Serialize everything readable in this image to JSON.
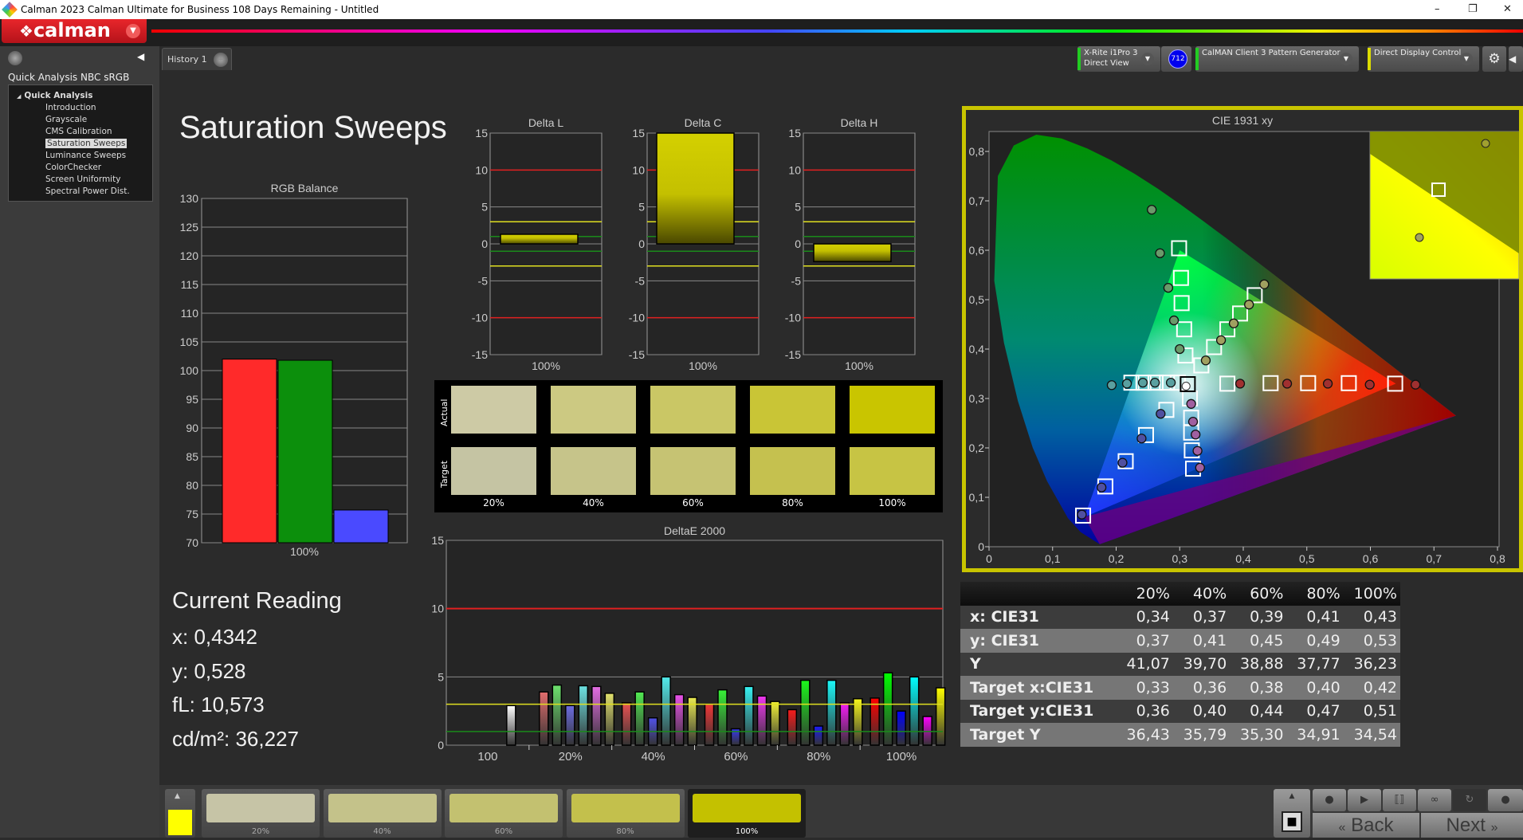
{
  "window": {
    "title": "Calman 2023 Calman Ultimate for Business 108 Days Remaining  - Untitled",
    "min": "–",
    "restore": "❐",
    "close": "✕"
  },
  "logo": {
    "text": "calman",
    "menu_icon": "chevron-down-icon"
  },
  "sidebar": {
    "project": "Quick Analysis NBC sRGB",
    "root": "Quick Analysis",
    "items": [
      "Introduction",
      "Grayscale",
      "CMS Calibration",
      "Saturation Sweeps",
      "Luminance Sweeps",
      "ColorChecker",
      "Screen Uniformity",
      "Spectral Power Dist."
    ],
    "selected": "Saturation Sweeps"
  },
  "tabs": [
    {
      "label": "History 1"
    },
    {
      "label": "+"
    }
  ],
  "devices": {
    "meter": {
      "line1": "X-Rite i1Pro 3",
      "line2": "Direct View",
      "badge": "712",
      "status_color": "#22cc22"
    },
    "generator": {
      "label": "CalMAN Client 3 Pattern Generator",
      "status_color": "#22cc22"
    },
    "display": {
      "label": "Direct Display Control",
      "status_color": "#dddd00"
    },
    "settings_icon": "gear-icon"
  },
  "page_title": "Saturation Sweeps",
  "current_reading": {
    "heading": "Current Reading",
    "x": "x: 0,4342",
    "y": "y: 0,528",
    "fl": "fL: 10,573",
    "cdm2": "cd/m²: 36,227"
  },
  "chart_data": [
    {
      "id": "rgb_balance",
      "type": "bar",
      "title": "RGB Balance",
      "categories": [
        "100%"
      ],
      "series": [
        {
          "values": [
            102.0
          ],
          "color": "#ff2a2a"
        },
        {
          "values": [
            101.8
          ],
          "color": "#0c8f0c"
        },
        {
          "values": [
            75.7
          ],
          "color": "#4a4aff"
        }
      ],
      "ylim": [
        70,
        130
      ],
      "yticks": [
        70,
        75,
        80,
        85,
        90,
        95,
        100,
        105,
        110,
        115,
        120,
        125,
        130
      ],
      "grid": true
    },
    {
      "id": "delta_l",
      "type": "bar",
      "title": "Delta L",
      "categories": [
        "100%"
      ],
      "values": [
        1.3
      ],
      "ylim": [
        -15,
        15
      ],
      "yticks": [
        -15,
        -10,
        -5,
        0,
        5,
        10,
        15
      ],
      "grid": true,
      "ref_lines": {
        "red": 10,
        "yellow": 3,
        "green": 1
      }
    },
    {
      "id": "delta_c",
      "type": "bar",
      "title": "Delta C",
      "categories": [
        "100%"
      ],
      "values": [
        15
      ],
      "ylim": [
        -15,
        15
      ],
      "yticks": [
        -15,
        -10,
        -5,
        0,
        5,
        10,
        15
      ],
      "grid": true,
      "ref_lines": {
        "red": 10,
        "yellow": 3,
        "green": 1
      }
    },
    {
      "id": "delta_h",
      "type": "bar",
      "title": "Delta H",
      "categories": [
        "100%"
      ],
      "values": [
        -2.4
      ],
      "ylim": [
        -15,
        15
      ],
      "yticks": [
        -15,
        -10,
        -5,
        0,
        5,
        10,
        15
      ],
      "grid": true,
      "ref_lines": {
        "red": 10,
        "yellow": 3,
        "green": 1
      }
    },
    {
      "id": "deltae_2000",
      "type": "bar",
      "title": "DeltaE 2000",
      "categories": [
        "100",
        "20%",
        "40%",
        "60%",
        "80%",
        "100%"
      ],
      "groups": [
        {
          "label": "100",
          "bars": [
            {
              "color": "#ffffff",
              "value": 2.9
            }
          ]
        },
        {
          "label": "20%",
          "saturation": 0.2,
          "bars": [
            {
              "color": "#ff0000",
              "value": 3.9
            },
            {
              "color": "#00ff00",
              "value": 4.4
            },
            {
              "color": "#0000ff",
              "value": 2.9
            },
            {
              "color": "#00ffff",
              "value": 4.35
            },
            {
              "color": "#ff00ff",
              "value": 4.3
            },
            {
              "color": "#ffff00",
              "value": 3.8
            }
          ]
        },
        {
          "label": "40%",
          "saturation": 0.4,
          "bars": [
            {
              "color": "#ff0000",
              "value": 3.1
            },
            {
              "color": "#00ff00",
              "value": 3.9
            },
            {
              "color": "#0000ff",
              "value": 2.0
            },
            {
              "color": "#00ffff",
              "value": 5.0
            },
            {
              "color": "#ff00ff",
              "value": 3.7
            },
            {
              "color": "#ffff00",
              "value": 3.5
            }
          ]
        },
        {
          "label": "60%",
          "saturation": 0.6,
          "bars": [
            {
              "color": "#ff0000",
              "value": 3.0
            },
            {
              "color": "#00ff00",
              "value": 4.05
            },
            {
              "color": "#0000ff",
              "value": 1.2
            },
            {
              "color": "#00ffff",
              "value": 4.3
            },
            {
              "color": "#ff00ff",
              "value": 3.6
            },
            {
              "color": "#ffff00",
              "value": 3.2
            }
          ]
        },
        {
          "label": "80%",
          "saturation": 0.8,
          "bars": [
            {
              "color": "#ff0000",
              "value": 2.6
            },
            {
              "color": "#00ff00",
              "value": 4.75
            },
            {
              "color": "#0000ff",
              "value": 1.4
            },
            {
              "color": "#00ffff",
              "value": 4.75
            },
            {
              "color": "#ff00ff",
              "value": 3.1
            },
            {
              "color": "#ffff00",
              "value": 3.4
            }
          ]
        },
        {
          "label": "100%",
          "saturation": 1.0,
          "bars": [
            {
              "color": "#ff0000",
              "value": 3.45
            },
            {
              "color": "#00ff00",
              "value": 5.3
            },
            {
              "color": "#0000ff",
              "value": 2.5
            },
            {
              "color": "#00ffff",
              "value": 5.0
            },
            {
              "color": "#ff00ff",
              "value": 2.1
            },
            {
              "color": "#ffff00",
              "value": 4.2
            }
          ]
        }
      ],
      "ylim": [
        0,
        15
      ],
      "yticks": [
        0,
        5,
        10,
        15
      ],
      "grid": true,
      "ref_lines": {
        "red": 10,
        "yellow": 3,
        "green": 1
      }
    },
    {
      "id": "cie1931",
      "type": "scatter",
      "title": "CIE 1931 xy",
      "xlim": [
        0,
        0.8
      ],
      "ylim": [
        0,
        0.8
      ],
      "xticks": [
        "0",
        "0,1",
        "0,2",
        "0,3",
        "0,4",
        "0,5",
        "0,6",
        "0,7",
        "0,8"
      ],
      "yticks": [
        "0",
        "0,1",
        "0,2",
        "0,3",
        "0,4",
        "0,5",
        "0,6",
        "0,7",
        "0,8"
      ],
      "gamut": {
        "red": [
          0.64,
          0.33
        ],
        "green": [
          0.3,
          0.6
        ],
        "blue": [
          0.15,
          0.06
        ]
      },
      "white": {
        "target": [
          0.3127,
          0.329
        ],
        "actual": [
          0.31,
          0.325
        ]
      },
      "sweeps": [
        {
          "color": "red",
          "targets": [
            [
              0.375,
              0.33
            ],
            [
              0.443,
              0.331
            ],
            [
              0.502,
              0.331
            ],
            [
              0.566,
              0.331
            ],
            [
              0.639,
              0.33
            ]
          ],
          "actual": [
            [
              0.395,
              0.33
            ],
            [
              0.469,
              0.33
            ],
            [
              0.533,
              0.33
            ],
            [
              0.599,
              0.328
            ],
            [
              0.671,
              0.328
            ]
          ]
        },
        {
          "color": "green",
          "targets": [
            [
              0.309,
              0.387
            ],
            [
              0.307,
              0.44
            ],
            [
              0.303,
              0.493
            ],
            [
              0.302,
              0.544
            ],
            [
              0.299,
              0.604
            ]
          ],
          "actual": [
            [
              0.3,
              0.4
            ],
            [
              0.291,
              0.458
            ],
            [
              0.282,
              0.524
            ],
            [
              0.269,
              0.594
            ],
            [
              0.256,
              0.682
            ]
          ]
        },
        {
          "color": "blue",
          "targets": [
            [
              0.279,
              0.277
            ],
            [
              0.247,
              0.226
            ],
            [
              0.215,
              0.173
            ],
            [
              0.183,
              0.122
            ],
            [
              0.148,
              0.063
            ]
          ],
          "actual": [
            [
              0.27,
              0.269
            ],
            [
              0.24,
              0.219
            ],
            [
              0.21,
              0.17
            ],
            [
              0.177,
              0.12
            ],
            [
              0.146,
              0.065
            ]
          ]
        },
        {
          "color": "cyan",
          "targets": [
            [
              0.297,
              0.332
            ],
            [
              0.28,
              0.332
            ],
            [
              0.262,
              0.332
            ],
            [
              0.243,
              0.332
            ],
            [
              0.224,
              0.332
            ]
          ],
          "actual": [
            [
              0.286,
              0.332
            ],
            [
              0.261,
              0.332
            ],
            [
              0.242,
              0.332
            ],
            [
              0.217,
              0.33
            ],
            [
              0.193,
              0.327
            ]
          ]
        },
        {
          "color": "magenta",
          "targets": [
            [
              0.316,
              0.3
            ],
            [
              0.318,
              0.261
            ],
            [
              0.318,
              0.231
            ],
            [
              0.319,
              0.195
            ],
            [
              0.321,
              0.158
            ]
          ],
          "actual": [
            [
              0.318,
              0.289
            ],
            [
              0.321,
              0.253
            ],
            [
              0.325,
              0.227
            ],
            [
              0.328,
              0.194
            ],
            [
              0.332,
              0.16
            ]
          ]
        },
        {
          "color": "yellow",
          "targets": [
            [
              0.334,
              0.367
            ],
            [
              0.354,
              0.404
            ],
            [
              0.375,
              0.44
            ],
            [
              0.395,
              0.472
            ],
            [
              0.418,
              0.509
            ]
          ],
          "actual": [
            [
              0.341,
              0.377
            ],
            [
              0.365,
              0.418
            ],
            [
              0.385,
              0.452
            ],
            [
              0.409,
              0.49
            ],
            [
              0.433,
              0.531
            ]
          ]
        }
      ]
    }
  ],
  "swatches": {
    "row_labels": [
      "Actual",
      "Target"
    ],
    "labels": [
      "20%",
      "40%",
      "60%",
      "80%",
      "100%"
    ],
    "actual": [
      "#cdcaa5",
      "#ccc982",
      "#cac765",
      "#c9c536",
      "#c9c500"
    ],
    "target": [
      "#c5c4a3",
      "#c6c48a",
      "#c6c373",
      "#c5c14f",
      "#c7c444"
    ]
  },
  "table": {
    "columns": [
      "",
      "20%",
      "40%",
      "60%",
      "80%",
      "100%"
    ],
    "rows": [
      [
        "x: CIE31",
        "0,34",
        "0,37",
        "0,39",
        "0,41",
        "0,43"
      ],
      [
        "y: CIE31",
        "0,37",
        "0,41",
        "0,45",
        "0,49",
        "0,53"
      ],
      [
        "Y",
        "41,07",
        "39,70",
        "38,88",
        "37,77",
        "36,23"
      ],
      [
        "Target x:CIE31",
        "0,33",
        "0,36",
        "0,38",
        "0,40",
        "0,42"
      ],
      [
        "Target y:CIE31",
        "0,36",
        "0,40",
        "0,44",
        "0,47",
        "0,51"
      ],
      [
        "Target Y",
        "36,43",
        "35,79",
        "35,30",
        "34,91",
        "34,54"
      ]
    ]
  },
  "bottom": {
    "current_color": "#ffff00",
    "patches": [
      {
        "label": "20%",
        "color": "#c6c4a6"
      },
      {
        "label": "40%",
        "color": "#c4c28a"
      },
      {
        "label": "60%",
        "color": "#c3c170"
      },
      {
        "label": "80%",
        "color": "#c3c04c"
      },
      {
        "label": "100%",
        "color": "#c4c100",
        "selected": true
      }
    ],
    "back": "Back",
    "next": "Next"
  }
}
